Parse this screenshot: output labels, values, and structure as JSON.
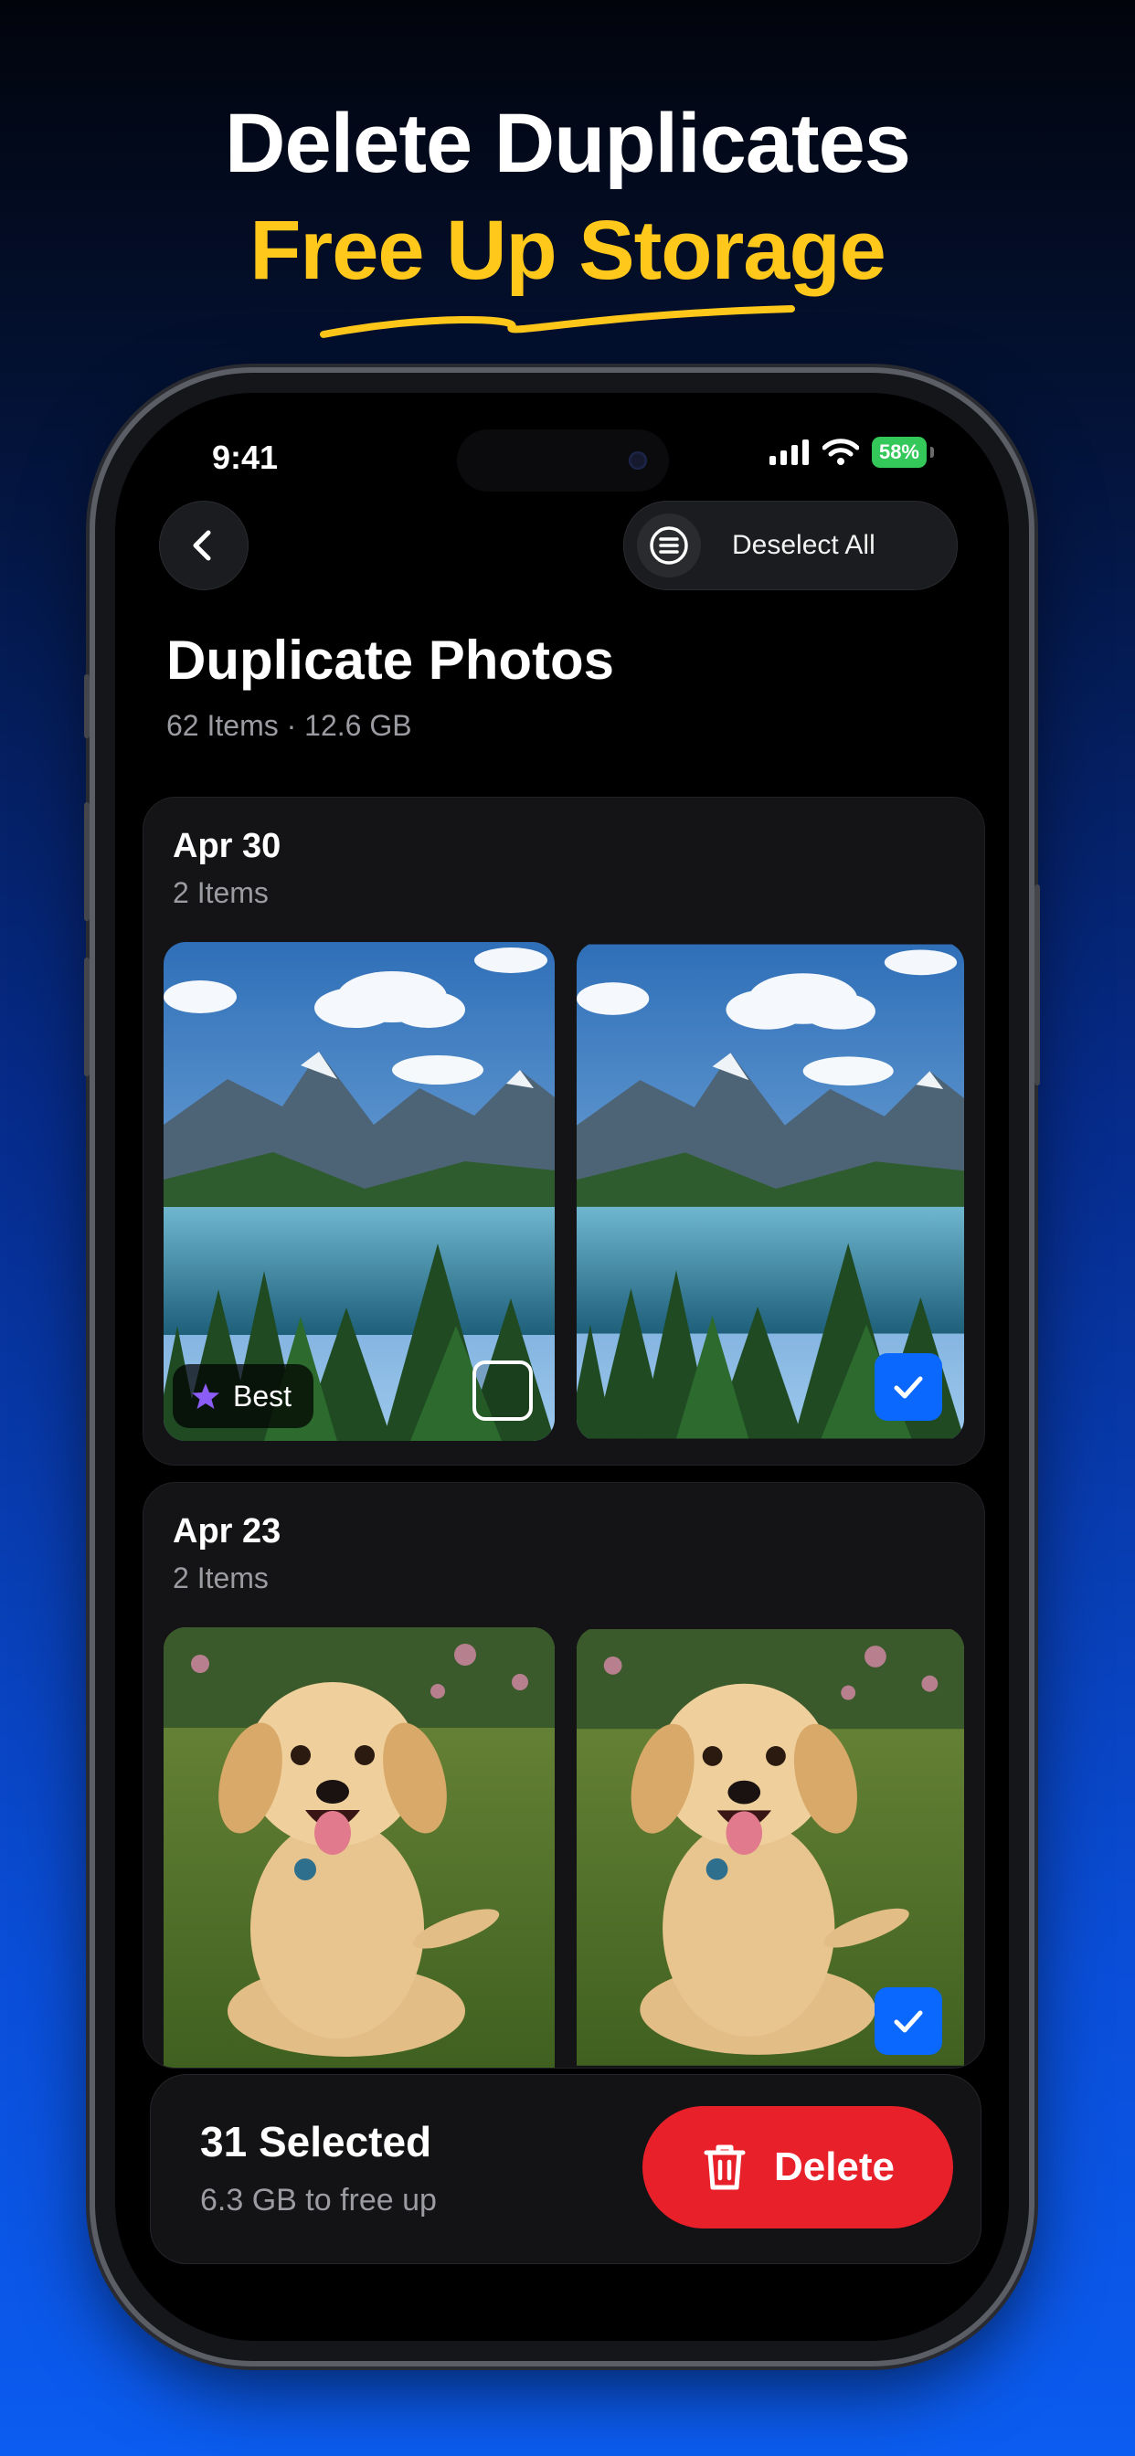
{
  "promo": {
    "line1": "Delete Duplicates",
    "line2": "Free Up Storage",
    "accent": "#ffc81a"
  },
  "status": {
    "time": "9:41",
    "battery": "58%",
    "icons": [
      "signal-icon",
      "wifi-icon",
      "battery-icon"
    ]
  },
  "nav": {
    "back_icon": "chevron-left-icon",
    "deselect_label": "Deselect All",
    "deselect_icon": "list-icon"
  },
  "page": {
    "title": "Duplicate Photos",
    "subtitle": "62 Items · 12.6 GB"
  },
  "groups": [
    {
      "date": "Apr 30",
      "count": "2 Items",
      "photos": [
        {
          "subject": "mountain-lake",
          "badge": "Best",
          "selected": false
        },
        {
          "subject": "mountain-lake",
          "badge": "",
          "selected": true
        }
      ]
    },
    {
      "date": "Apr 23",
      "count": "2 Items",
      "photos": [
        {
          "subject": "golden-retriever-puppy",
          "badge": "",
          "selected": false
        },
        {
          "subject": "golden-retriever-puppy",
          "badge": "",
          "selected": true
        }
      ]
    }
  ],
  "selection": {
    "count_label": "31 Selected",
    "size_label": "6.3 GB to free up",
    "delete_label": "Delete",
    "delete_color": "#e8202a",
    "check_color": "#0b68ff"
  }
}
